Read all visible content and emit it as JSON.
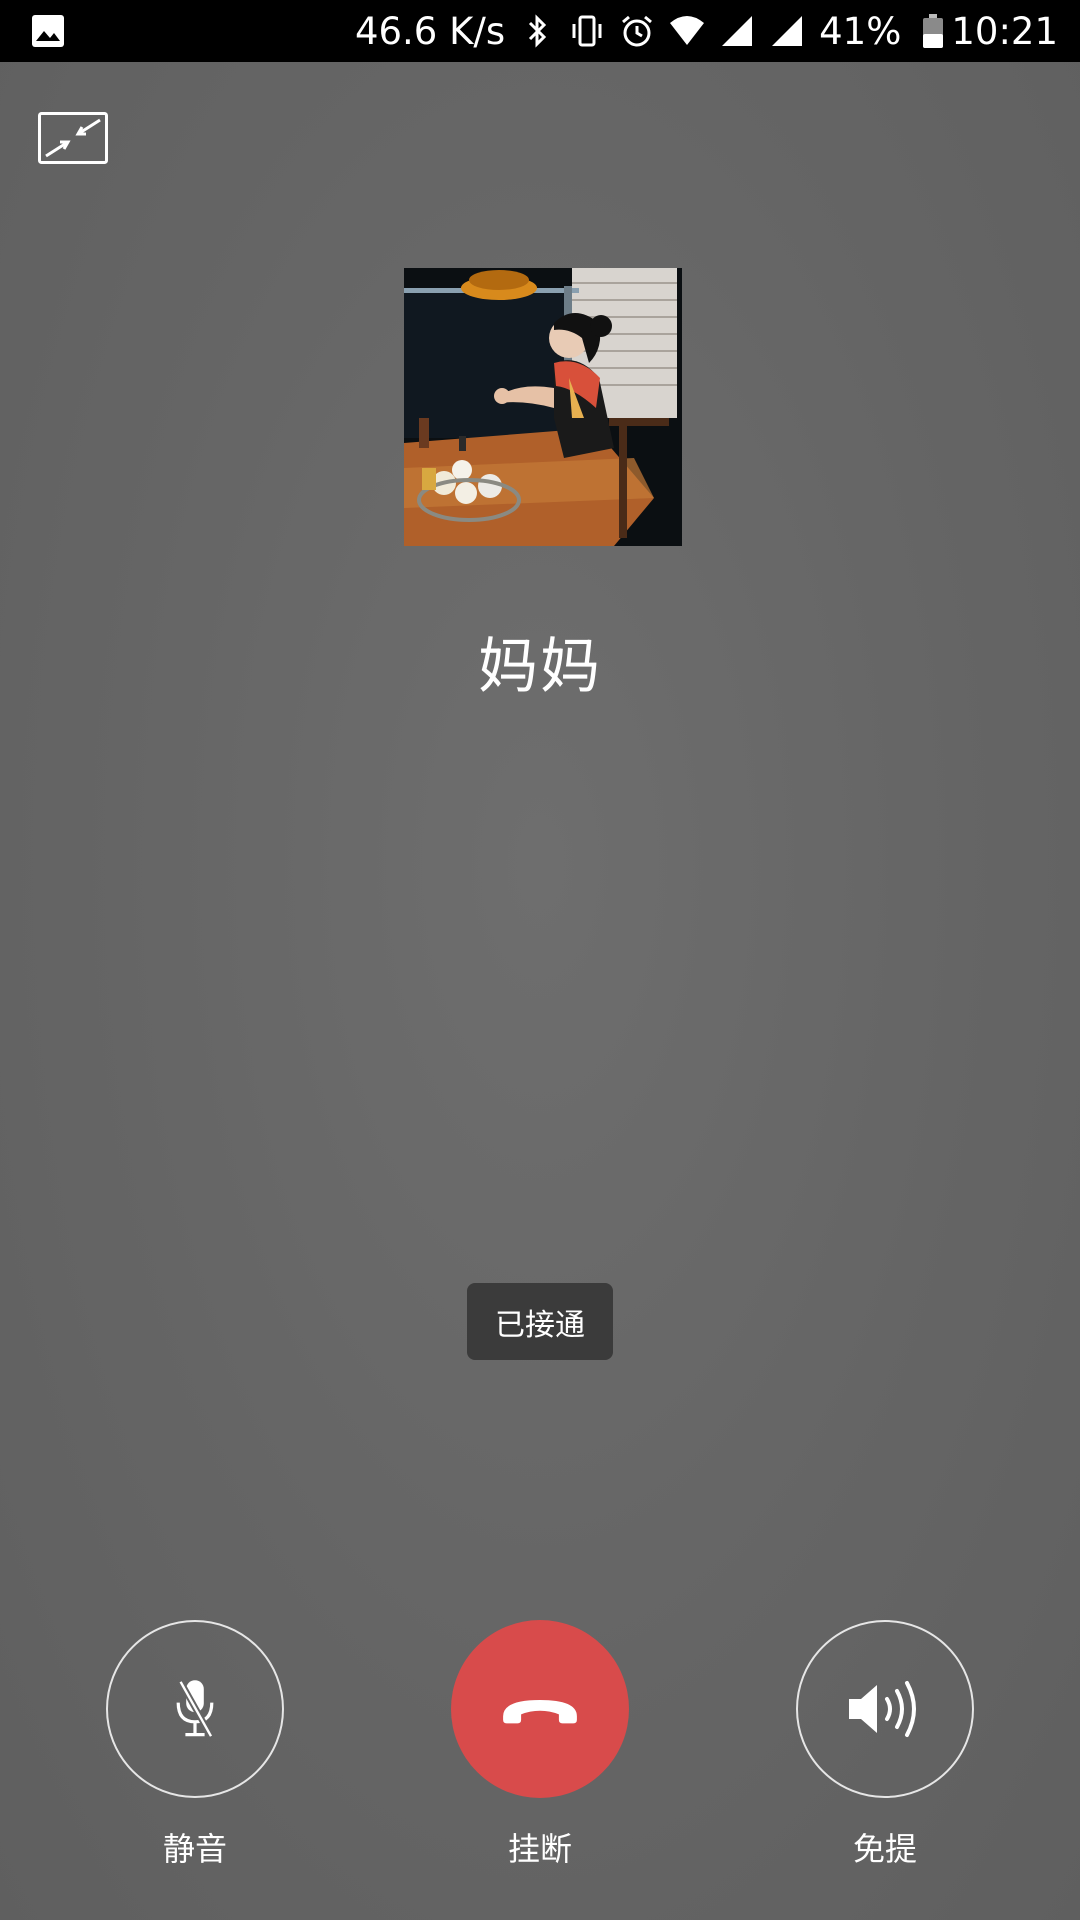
{
  "status_bar": {
    "net_speed": "46.6 K/s",
    "battery": "41%",
    "time": "10:21",
    "icons": [
      "image-icon",
      "bluetooth-icon",
      "vibrate-icon",
      "alarm-icon",
      "wifi-icon",
      "signal-icon",
      "signal-icon",
      "battery-icon"
    ]
  },
  "call": {
    "contact_name": "妈妈",
    "status_text": "已接通"
  },
  "controls": {
    "mute_label": "静音",
    "hangup_label": "挂断",
    "speaker_label": "免提"
  },
  "colors": {
    "background": "#646464",
    "hangup": "#d84b4b",
    "status_pill": "#3b3b3b"
  }
}
